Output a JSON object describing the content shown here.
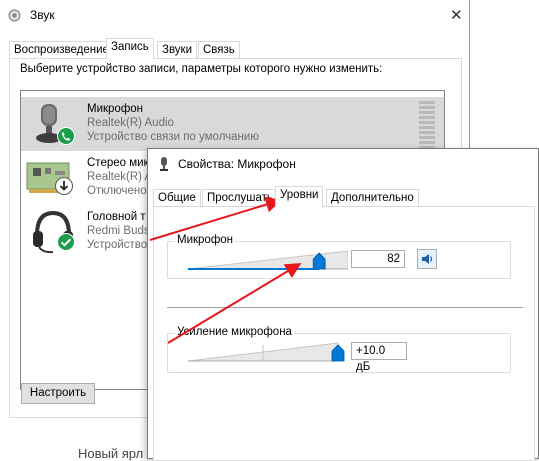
{
  "sound_window": {
    "title": "Звук",
    "tabs": [
      {
        "label": "Воспроизведение"
      },
      {
        "label": "Запись"
      },
      {
        "label": "Звуки"
      },
      {
        "label": "Связь"
      }
    ],
    "prompt": "Выберите устройство записи, параметры которого нужно изменить:",
    "devices": [
      {
        "name": "Микрофон",
        "driver": "Realtek(R) Audio",
        "status": "Устройство связи по умолчанию",
        "icon": "microphone-icon",
        "badge": "phone-badge-icon"
      },
      {
        "name": "Стерео мик",
        "driver": "Realtek(R) A",
        "status": "Отключено",
        "icon": "sound-card-icon",
        "badge": "down-arrow-badge-icon"
      },
      {
        "name": "Головной т",
        "driver": "Redmi Buds",
        "status": "Устройство",
        "icon": "headset-icon",
        "badge": "check-badge-icon"
      }
    ],
    "configure_label": "Настроить",
    "behind_text": "Новый ярл"
  },
  "properties_window": {
    "title": "Свойства: Микрофон",
    "tabs": [
      {
        "label": "Общие"
      },
      {
        "label": "Прослушать"
      },
      {
        "label": "Уровни"
      },
      {
        "label": "Дополнительно"
      }
    ],
    "active_tab": "Уровни",
    "microphone_level": {
      "label": "Микрофон",
      "value": "82",
      "fraction": 0.82
    },
    "microphone_boost": {
      "label": "Усиление микрофона",
      "value": "+10.0 дБ",
      "fraction": 1.0
    }
  },
  "colors": {
    "accent": "#0078d7",
    "annotation_arrow": "#e5181b",
    "selected_row": "#d9d9d9",
    "badge_green": "#1a9e4b"
  }
}
